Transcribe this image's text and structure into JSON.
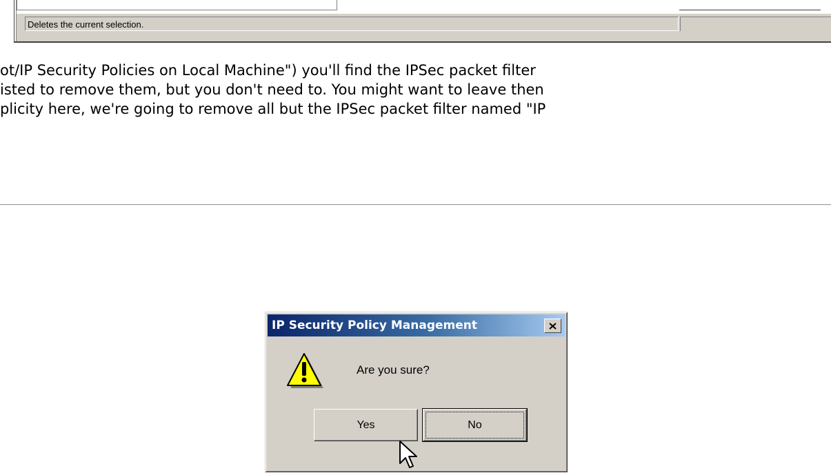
{
  "status_bar": {
    "text": "Deletes the current selection."
  },
  "article": {
    "lines": [
      "ot/IP Security Policies on Local Machine\") you'll find the IPSec packet filter",
      "isted to remove them, but you don't need to. You might want to leave then",
      "plicity here, we're going to remove all but the IPSec packet filter named \"IP"
    ]
  },
  "dialog": {
    "title": "IP Security Policy Management",
    "message": "Are you sure?",
    "yes_label": "Yes",
    "no_label": "No",
    "icon": "warning-icon",
    "close_icon": "close-icon"
  }
}
